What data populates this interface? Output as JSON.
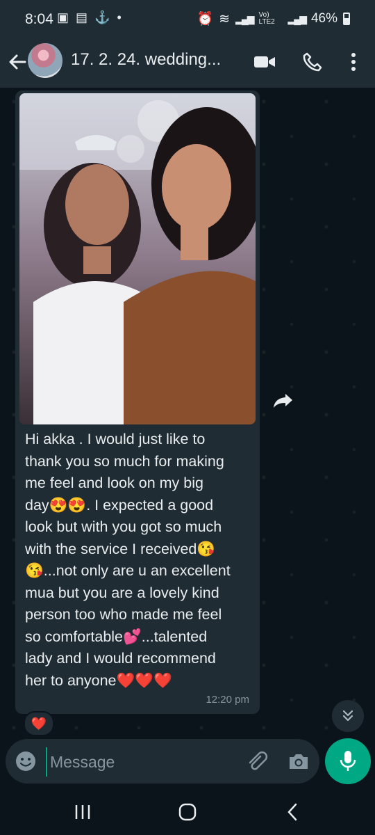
{
  "status": {
    "time": "8:04",
    "battery": "46%",
    "network_label": "Vo) LTE2"
  },
  "header": {
    "title": "17. 2. 24. wedding...",
    "icons": [
      "back-arrow-icon",
      "video-call-icon",
      "voice-call-icon",
      "more-options-icon"
    ]
  },
  "message": {
    "lines": [
      "Hi akka . I would just like to",
      "thank you so much for making",
      "me feel and look on my big",
      "day😍😍. I expected a good",
      "look but with you got so much",
      "with the service I received😘",
      "😘...not only are u an excellent",
      "mua but you are a lovely kind",
      "person too who made me feel",
      "so comfortable💕...talented",
      "lady and I would recommend",
      "her to anyone❤️❤️❤️"
    ],
    "time": "12:20 pm",
    "reaction": "❤️"
  },
  "composer": {
    "placeholder": "Message"
  },
  "colors": {
    "background": "#0b141a",
    "bar": "#1f2c34",
    "bubble": "#202c33",
    "accent": "#00a884",
    "text": "#e9edef",
    "muted": "#8696a0"
  }
}
